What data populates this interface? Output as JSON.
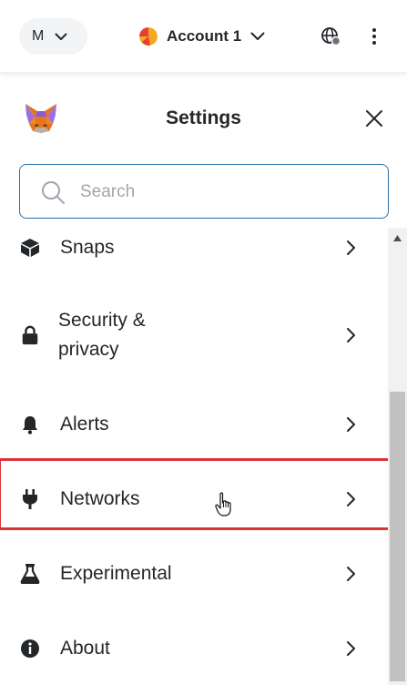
{
  "topbar": {
    "network_initial": "M",
    "account_name": "Account 1"
  },
  "settings": {
    "title": "Settings"
  },
  "search": {
    "placeholder": "Search"
  },
  "menu": [
    {
      "label": "Snaps",
      "icon": "snaps-cube-icon"
    },
    {
      "label": "Security &",
      "label2": "privacy",
      "icon": "lock-icon"
    },
    {
      "label": "Alerts",
      "icon": "bell-icon"
    },
    {
      "label": "Networks",
      "icon": "plug-icon"
    },
    {
      "label": "Experimental",
      "icon": "flask-icon"
    },
    {
      "label": "About",
      "icon": "info-icon"
    }
  ],
  "colors": {
    "accent_border": "#2a6fa3",
    "highlight": "#d8343a",
    "text": "#24272a",
    "placeholder": "#9fa6ae"
  }
}
